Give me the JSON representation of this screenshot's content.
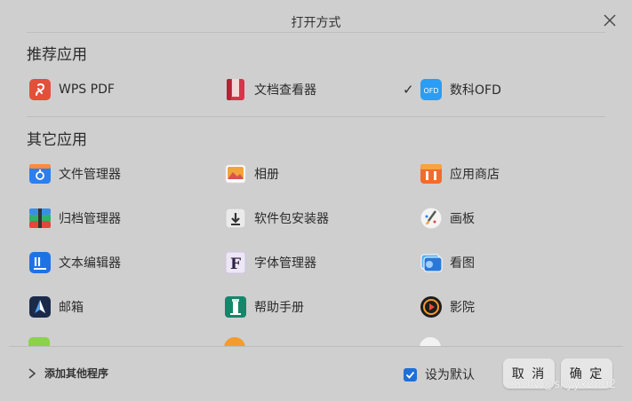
{
  "dialog": {
    "title": "打开方式"
  },
  "recommended": {
    "heading": "推荐应用",
    "apps": [
      {
        "label": "WPS PDF",
        "icon": "wps-pdf-icon"
      },
      {
        "label": "文档查看器",
        "icon": "document-viewer-icon"
      },
      {
        "label": "数科OFD",
        "icon": "ofd-icon",
        "checked": true
      }
    ]
  },
  "others": {
    "heading": "其它应用",
    "apps": [
      {
        "label": "文件管理器",
        "icon": "file-manager-icon"
      },
      {
        "label": "相册",
        "icon": "album-icon"
      },
      {
        "label": "应用商店",
        "icon": "app-store-icon"
      },
      {
        "label": "归档管理器",
        "icon": "archive-manager-icon"
      },
      {
        "label": "软件包安装器",
        "icon": "package-installer-icon"
      },
      {
        "label": "画板",
        "icon": "draw-icon"
      },
      {
        "label": "文本编辑器",
        "icon": "text-editor-icon"
      },
      {
        "label": "字体管理器",
        "icon": "font-manager-icon"
      },
      {
        "label": "看图",
        "icon": "image-viewer-icon"
      },
      {
        "label": "邮箱",
        "icon": "mail-icon"
      },
      {
        "label": "帮助手册",
        "icon": "manual-icon"
      },
      {
        "label": "影院",
        "icon": "movie-icon"
      }
    ]
  },
  "footer": {
    "add_other": "添加其他程序",
    "set_default": "设为默认",
    "set_default_checked": true,
    "cancel": "取 消",
    "confirm": "确 定"
  },
  "watermark": "CSDN @skyyx2002",
  "colors": {
    "accent": "#1e6fd9",
    "background": "#cfcfcf"
  }
}
